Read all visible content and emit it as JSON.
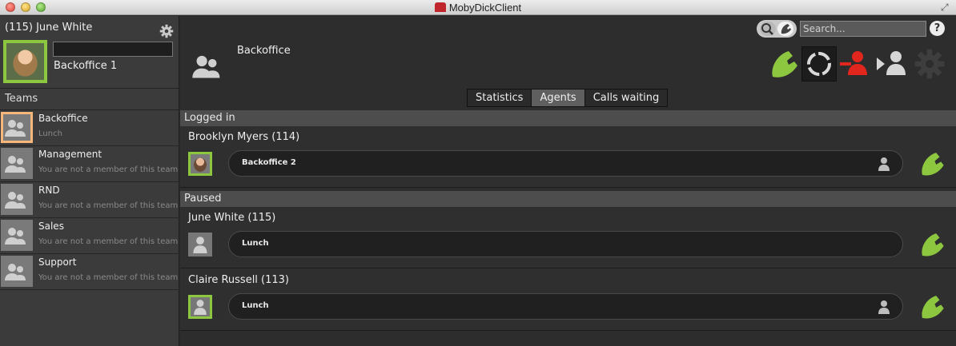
{
  "window": {
    "title": "MobyDickClient"
  },
  "user": {
    "name": "(115) June White",
    "status_value": "",
    "team": "Backoffice 1"
  },
  "sidebar": {
    "teams_heading": "Teams",
    "teams": [
      {
        "name": "Backoffice",
        "status": "Lunch",
        "active": true
      },
      {
        "name": "Management",
        "status": "You are not a member of this team"
      },
      {
        "name": "RND",
        "status": "You are not a member of this team"
      },
      {
        "name": "Sales",
        "status": "You are not a member of this team"
      },
      {
        "name": "Support",
        "status": "You are not a member of this team"
      }
    ]
  },
  "header": {
    "group_name": "Backoffice",
    "search_placeholder": "Search...",
    "help_label": "?"
  },
  "tabs": [
    {
      "label": "Statistics"
    },
    {
      "label": "Agents",
      "selected": true
    },
    {
      "label": "Calls waiting"
    }
  ],
  "sections": {
    "logged_in": "Logged in",
    "paused": "Paused"
  },
  "agents": [
    {
      "name": "Brooklyn Myers (114)",
      "status": "Backoffice 2"
    },
    {
      "name": "June White (115)",
      "status": "Lunch"
    },
    {
      "name": "Claire Russell (113)",
      "status": "Lunch"
    }
  ],
  "colors": {
    "accent_green": "#8dc63f",
    "hangup_red": "#e0261d",
    "active_team": "#f7b77a"
  }
}
